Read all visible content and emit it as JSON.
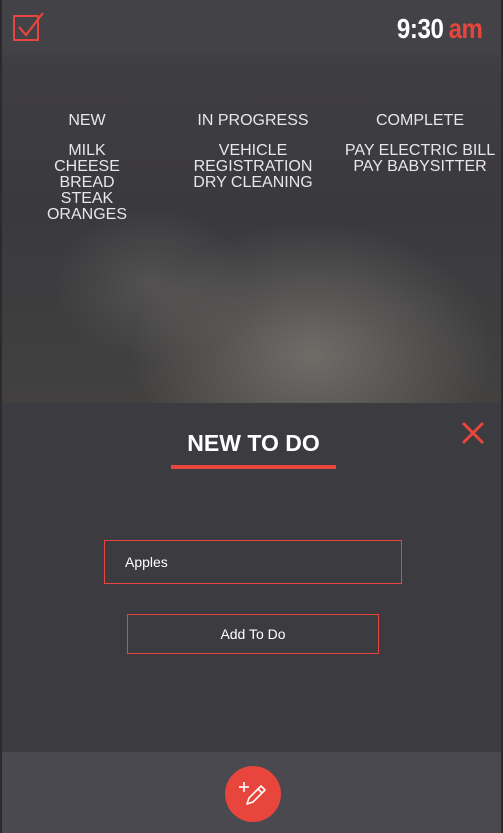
{
  "header": {
    "time": "9:30",
    "ampm": "am"
  },
  "board": {
    "columns": [
      {
        "title": "NEW",
        "items": [
          "MILK",
          "CHEESE",
          "BREAD",
          "STEAK",
          "ORANGES"
        ]
      },
      {
        "title": "IN PROGRESS",
        "items": [
          "VEHICLE",
          "REGISTRATION",
          "DRY CLEANING"
        ]
      },
      {
        "title": "COMPLETE",
        "items": [
          "PAY ELECTRIC BILL",
          "PAY BABYSITTER"
        ]
      }
    ]
  },
  "panel": {
    "title": "NEW TO DO",
    "input_value": "Apples",
    "add_button_label": "Add To Do"
  },
  "icons": {
    "logo": "checkbox-icon",
    "close": "close-icon",
    "fab": "add-edit-icon"
  },
  "colors": {
    "accent": "#e8453c",
    "background": "#3c3b40"
  }
}
